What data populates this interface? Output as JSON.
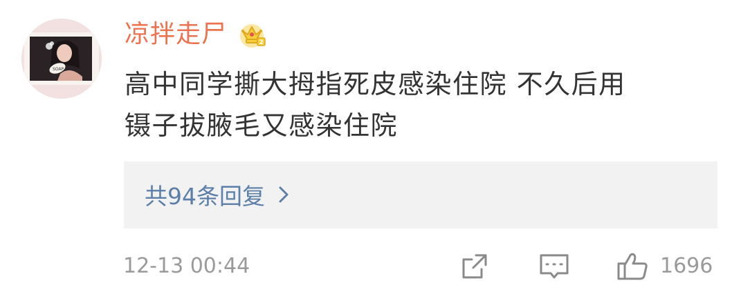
{
  "comment": {
    "username": "凉拌走尸",
    "badge_icon": "crown-icon",
    "content_line1": "高中同学撕大拇指死皮感染住院 不久后用",
    "content_line2": "镊子拔腋毛又感染住院",
    "replies_label": "共94条回复",
    "timestamp": "12-13 00:44",
    "like_count": "1696",
    "colors": {
      "username": "#eb7350",
      "reply_link": "#5b7fa8",
      "muted": "#9a9a9a",
      "reply_bg": "#f2f2f2"
    },
    "icons": [
      "forward-icon",
      "comment-icon",
      "thumbs-up-icon",
      "chevron-right-icon"
    ]
  }
}
